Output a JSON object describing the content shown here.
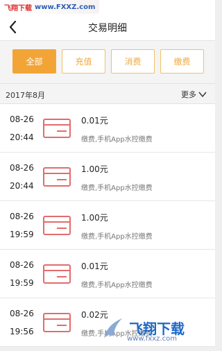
{
  "watermark": {
    "label": "飞翔下载",
    "url": "www.FXXZ.com"
  },
  "header": {
    "title": "交易明细"
  },
  "tabs": [
    "全部",
    "充值",
    "消费",
    "缴费"
  ],
  "filter": {
    "month": "2017年8月",
    "more": "更多"
  },
  "transactions": [
    {
      "date": "08-26",
      "time": "20:44",
      "amount": "0.01元",
      "description": "缴费,手机App水控缴费"
    },
    {
      "date": "08-26",
      "time": "20:44",
      "amount": "1.00元",
      "description": "缴费,手机App水控缴费"
    },
    {
      "date": "08-26",
      "time": "19:59",
      "amount": "1.00元",
      "description": "缴费,手机App水控缴费"
    },
    {
      "date": "08-26",
      "time": "19:59",
      "amount": "0.01元",
      "description": "缴费,手机App水控缴费"
    },
    {
      "date": "08-26",
      "time": "19:56",
      "amount": "0.02元",
      "description": "缴费,手机App水控缴费"
    }
  ],
  "brand": {
    "name": "飞翔下载",
    "site": "www.fxxz.com"
  },
  "colors": {
    "accent": "#f2a536",
    "card": "#e36b6b"
  }
}
